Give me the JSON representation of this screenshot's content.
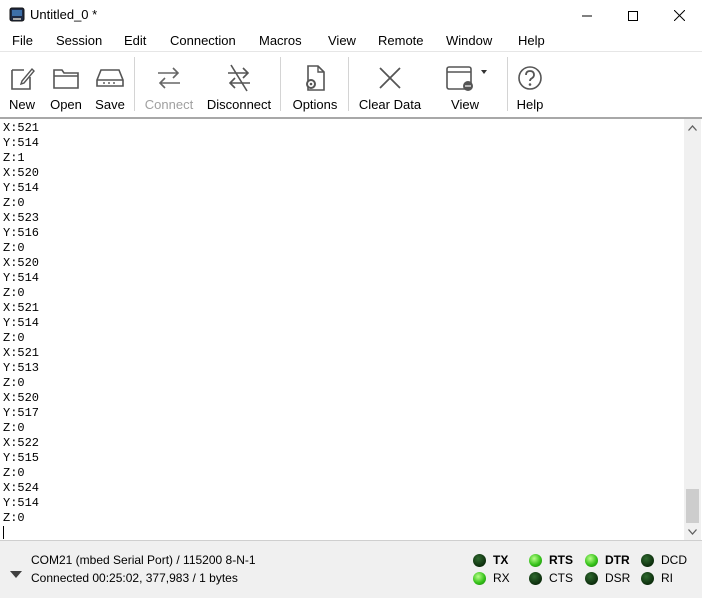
{
  "window": {
    "title": "Untitled_0 *",
    "minimize_icon": "minimize-icon",
    "maximize_icon": "maximize-icon",
    "close_icon": "close-icon"
  },
  "menu": [
    "File",
    "Session",
    "Edit",
    "Connection",
    "Macros",
    "View",
    "Remote",
    "Window",
    "Help"
  ],
  "toolbar": {
    "new": "New",
    "open": "Open",
    "save": "Save",
    "connect": "Connect",
    "disconnect": "Disconnect",
    "options": "Options",
    "clear_data": "Clear Data",
    "view": "View",
    "help": "Help"
  },
  "terminal": {
    "lines": [
      "X:521",
      "Y:514",
      "Z:1",
      "X:520",
      "Y:514",
      "Z:0",
      "X:523",
      "Y:516",
      "Z:0",
      "X:520",
      "Y:514",
      "Z:0",
      "X:521",
      "Y:514",
      "Z:0",
      "X:521",
      "Y:513",
      "Z:0",
      "X:520",
      "Y:517",
      "Z:0",
      "X:522",
      "Y:515",
      "Z:0",
      "X:524",
      "Y:514",
      "Z:0"
    ]
  },
  "status": {
    "port_line": "COM21 (mbed Serial Port) / 115200 8-N-1",
    "connection_line": "Connected 00:25:02, 377,983 / 1 bytes",
    "signals": {
      "tx": {
        "label": "TX",
        "active": false
      },
      "rx": {
        "label": "RX",
        "active": true
      },
      "rts": {
        "label": "RTS",
        "active": true
      },
      "cts": {
        "label": "CTS",
        "active": false
      },
      "dtr": {
        "label": "DTR",
        "active": true
      },
      "dsr": {
        "label": "DSR",
        "active": false
      },
      "dcd": {
        "label": "DCD",
        "active": false
      },
      "ri": {
        "label": "RI",
        "active": false
      }
    }
  }
}
